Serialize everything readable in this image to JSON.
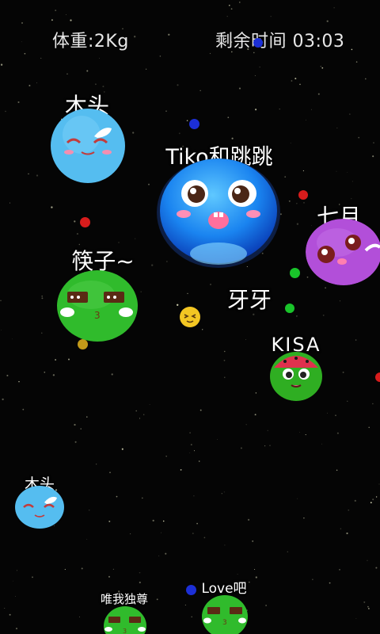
{
  "hud": {
    "weight_label": "体重:2Kg",
    "time_label": "剩余时间 03:03"
  },
  "players": [
    {
      "name": "木头",
      "skin": "sky-blue-squint-face",
      "color": "#52b9ef"
    },
    {
      "name": "Tiko和跳跳",
      "skin": "blue-jelly-octopus",
      "color": "#1f7cf2"
    },
    {
      "name": "七月",
      "skin": "purple-bear-face",
      "color": "#b04fd8"
    },
    {
      "name": "筷子~",
      "skin": "green-chocolate-face",
      "color": "#2fba2a"
    },
    {
      "name": "牙牙",
      "skin": "yellow-squint-emoji",
      "color": "#f3c623"
    },
    {
      "name": "KISA",
      "skin": "watermelon-face",
      "color": "#2fae22"
    },
    {
      "name": "木头",
      "skin": "sky-blue-squint-face",
      "color": "#52b9ef"
    },
    {
      "name": "唯我独尊",
      "skin": "green-chocolate-face",
      "color": "#2fba2a"
    },
    {
      "name": "Love吧",
      "skin": "green-chocolate-face",
      "color": "#2fba2a"
    }
  ],
  "pellet_colors": [
    "#1c2fd6",
    "#d81c1c",
    "#19c42a",
    "#e0b01c"
  ]
}
